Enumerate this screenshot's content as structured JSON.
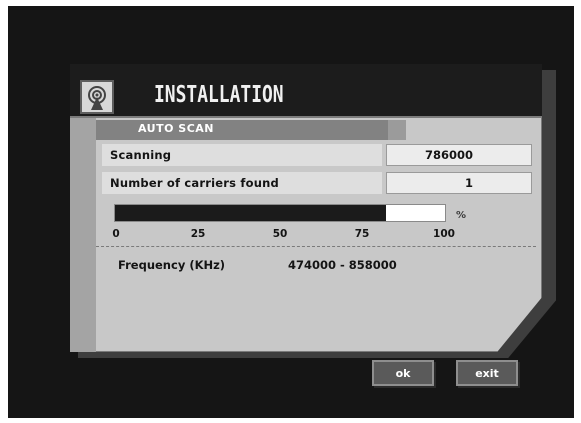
{
  "dialog": {
    "title": "INSTALLATION",
    "subtitle": "AUTO SCAN",
    "icon": "satellite-dish-icon"
  },
  "rows": [
    {
      "label": "Scanning",
      "value": "786000"
    },
    {
      "label": "Number of carriers found",
      "value": "1"
    }
  ],
  "progress": {
    "percent": 82,
    "unit": "%",
    "ticks": [
      "0",
      "25",
      "50",
      "75",
      "100"
    ]
  },
  "frequency": {
    "label": "Frequency (KHz)",
    "range": "474000 - 858000"
  },
  "buttons": {
    "ok": "ok",
    "exit": "exit"
  }
}
